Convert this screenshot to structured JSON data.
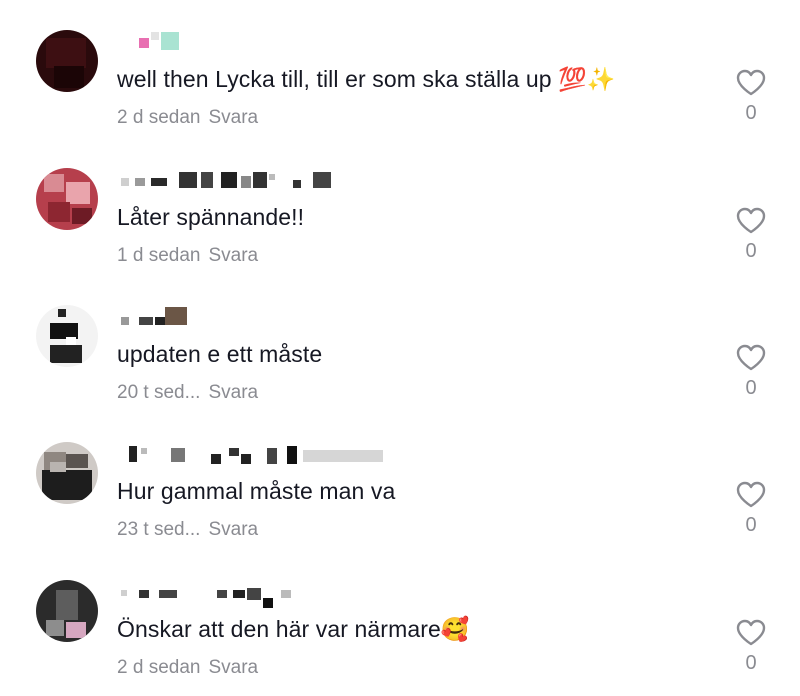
{
  "comments": [
    {
      "text": "well then Lycka till, till er som ska ställa up 💯✨",
      "time": "2 d sedan",
      "reply_label": "Svara",
      "likes": "0",
      "avatar_colors": [
        "#3a0e10",
        "#1f0608",
        "#4b1216"
      ]
    },
    {
      "text": "Låter spännande!!",
      "time": "1 d sedan",
      "reply_label": "Svara",
      "likes": "0",
      "avatar_colors": [
        "#c94a55",
        "#e07a83",
        "#8e2b38"
      ]
    },
    {
      "text": "updaten e ett måste",
      "time": "20 t sed...",
      "reply_label": "Svara",
      "likes": "0",
      "avatar_colors": [
        "#111111",
        "#e6e6e6",
        "#4a4a4a"
      ]
    },
    {
      "text": "Hur gammal måste man va",
      "time": "23 t sed...",
      "reply_label": "Svara",
      "likes": "0",
      "avatar_colors": [
        "#2a2a2a",
        "#b9b4b0",
        "#5a5450"
      ]
    },
    {
      "text": "Önskar att den här var närmare🥰",
      "time": "2 d sedan",
      "reply_label": "Svara",
      "likes": "0",
      "avatar_colors": [
        "#2b2b2b",
        "#8d8d8d",
        "#d6a7c0"
      ]
    }
  ],
  "icons": {
    "like": "heart-outline-icon"
  },
  "colors": {
    "text": "#161823",
    "meta": "#8a8b91",
    "background": "#ffffff"
  }
}
